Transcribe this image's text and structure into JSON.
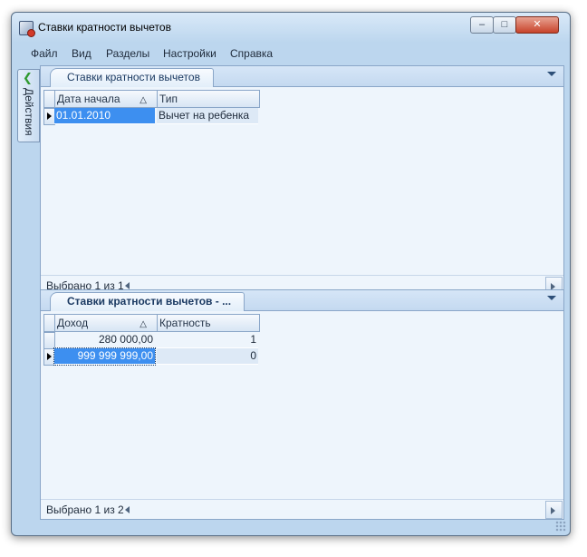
{
  "window": {
    "title": "Ставки кратности вычетов",
    "controls": {
      "minimize": "–",
      "maximize": "□",
      "close": "✕"
    }
  },
  "menu": [
    "Файл",
    "Вид",
    "Разделы",
    "Настройки",
    "Справка"
  ],
  "sidebar": {
    "actions_label": "Действия",
    "actions_icon": "green-arrow-icon"
  },
  "top_panel": {
    "tab_label": "Ставки кратности вычетов",
    "columns": [
      "Дата начала",
      "Тип"
    ],
    "rows": [
      {
        "date": "01.01.2010",
        "type": "Вычет на ребенка"
      }
    ],
    "status": "Выбрано 1 из 1"
  },
  "bottom_panel": {
    "tab_label": "Ставки кратности вычетов - ...",
    "columns": [
      "Доход",
      "Кратность"
    ],
    "rows": [
      {
        "income": "280 000,00",
        "ratio": "1"
      },
      {
        "income": "999 999 999,00",
        "ratio": "0"
      }
    ],
    "status": "Выбрано 1 из 2"
  },
  "colors": {
    "selection": "#3d8ff0",
    "window_frame": "#bcd6ee",
    "panel_bg": "#eef5fc"
  }
}
